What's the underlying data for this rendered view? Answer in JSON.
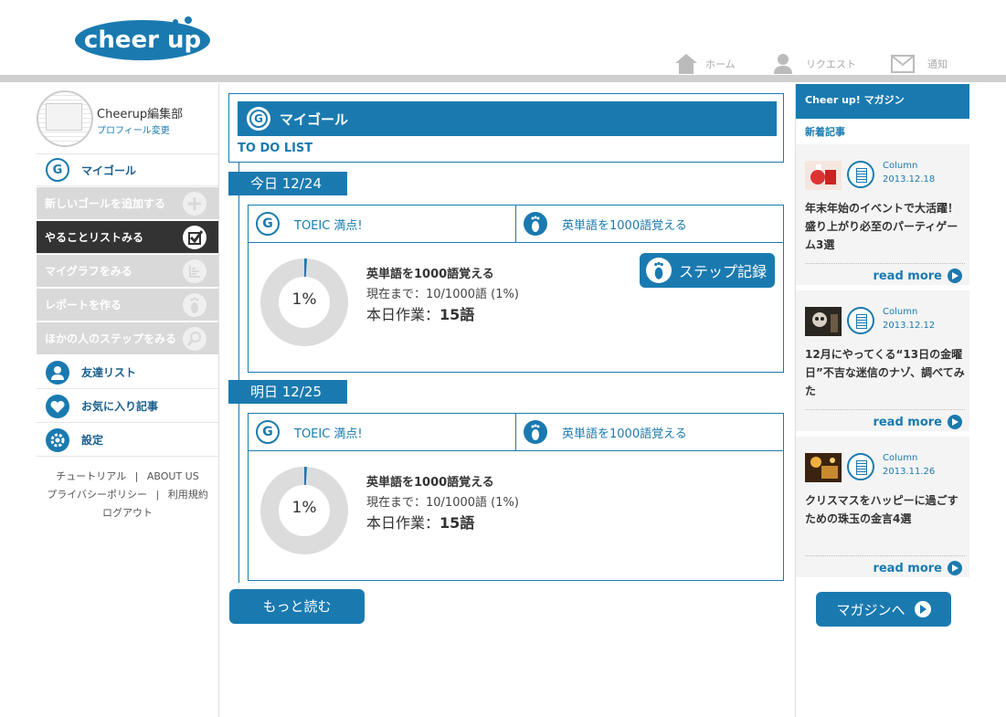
{
  "header": {
    "logo_text": "cheer up",
    "nav": [
      {
        "label": "ホーム",
        "icon": "home-icon"
      },
      {
        "label": "リクエスト",
        "icon": "user-icon"
      },
      {
        "label": "通知",
        "icon": "mail-icon"
      }
    ]
  },
  "sidebar": {
    "profile_name": "Cheerup編集部",
    "profile_edit": "プロフィール変更",
    "items": [
      {
        "label": "マイゴール"
      },
      {
        "label": "新しいゴールを追加する"
      },
      {
        "label": "やることリストみる"
      },
      {
        "label": "マイグラフをみる"
      },
      {
        "label": "レポートを作る"
      },
      {
        "label": "ほかの人のステップをみる"
      },
      {
        "label": "友達リスト"
      },
      {
        "label": "お気に入り記事"
      },
      {
        "label": "設定"
      }
    ],
    "footer": {
      "tutorial": "チュートリアル",
      "about": "ABOUT US",
      "privacy": "プライバシーポリシー",
      "terms": "利用規約",
      "logout": "ログアウト",
      "sep": "|"
    }
  },
  "main": {
    "goal_title": "マイゴール",
    "goal_icon_letter": "G",
    "todo_label": "TO DO LIST",
    "step_button": "ステップ記録",
    "more_button": "もっと読む",
    "days": [
      {
        "date": "今日 12/24",
        "tab1": "TOEIC 満点!",
        "tab2": "英単語を1000語覚える",
        "goal_name": "英単語を1000語覚える",
        "progress_text": "現在まで：10/1000語 (1%)",
        "progress_percent": 1,
        "percent_label": "1%",
        "today_label": "本日作業：",
        "today_value": "15語"
      },
      {
        "date": "明日 12/25",
        "tab1": "TOEIC 満点!",
        "tab2": "英単語を1000語覚える",
        "goal_name": "英単語を1000語覚える",
        "progress_text": "現在まで：10/1000語 (1%)",
        "progress_percent": 1,
        "percent_label": "1%",
        "today_label": "本日作業：",
        "today_value": "15語"
      }
    ]
  },
  "magazine": {
    "header": "Cheer up! マガジン",
    "new_label": "新着記事",
    "read_more": "read more",
    "button": "マガジンへ",
    "articles": [
      {
        "category": "Column",
        "date": "2013.12.18",
        "title": "年末年始のイベントで大活躍！盛り上がり必至のパーティゲーム3選"
      },
      {
        "category": "Column",
        "date": "2013.12.12",
        "title": "12月にやってくる“13日の金曜日”不吉な迷信のナゾ、調べてみた"
      },
      {
        "category": "Column",
        "date": "2013.11.26",
        "title": "クリスマスをハッピーに過ごすための珠玉の金言4選"
      }
    ]
  },
  "colors": {
    "primary": "#1a7ab0",
    "gray_menu": "#d9d9d9",
    "dark_menu": "#333333"
  }
}
